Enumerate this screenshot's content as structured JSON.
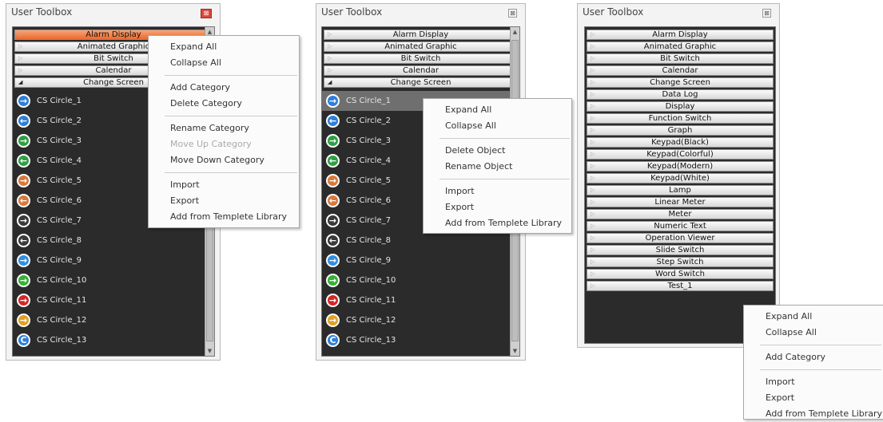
{
  "panel1": {
    "title": "User Toolbox",
    "categories": [
      {
        "label": "Alarm Display"
      },
      {
        "label": "Animated Graphic"
      },
      {
        "label": "Bit Switch"
      },
      {
        "label": "Calendar"
      },
      {
        "label": "Change Screen"
      }
    ],
    "items": [
      {
        "label": "CS Circle_1",
        "color": "#2f7fd8",
        "arrow": "→"
      },
      {
        "label": "CS Circle_2",
        "color": "#2f7fd8",
        "arrow": "←"
      },
      {
        "label": "CS Circle_3",
        "color": "#2ea043",
        "arrow": "→"
      },
      {
        "label": "CS Circle_4",
        "color": "#2ea043",
        "arrow": "←"
      },
      {
        "label": "CS Circle_5",
        "color": "#d9783a",
        "arrow": "→"
      },
      {
        "label": "CS Circle_6",
        "color": "#d9783a",
        "arrow": "←"
      },
      {
        "label": "CS Circle_7",
        "color": "#3a3a3a",
        "arrow": "→"
      },
      {
        "label": "CS Circle_8",
        "color": "#3a3a3a",
        "arrow": "←"
      },
      {
        "label": "CS Circle_9",
        "color": "#2f8fe0",
        "arrow": "→"
      },
      {
        "label": "CS Circle_10",
        "color": "#34b233",
        "arrow": "→"
      },
      {
        "label": "CS Circle_11",
        "color": "#d42626",
        "arrow": "→"
      },
      {
        "label": "CS Circle_12",
        "color": "#e0a020",
        "arrow": "→"
      },
      {
        "label": "CS Circle_13",
        "color": "#2f7fd8",
        "arrow": "C"
      }
    ],
    "menu": [
      {
        "label": "Expand All"
      },
      {
        "label": "Collapse All"
      },
      {
        "sep": true
      },
      {
        "label": "Add Category"
      },
      {
        "label": "Delete Category"
      },
      {
        "sep": true
      },
      {
        "label": "Rename Category"
      },
      {
        "label": "Move Up Category",
        "disabled": true
      },
      {
        "label": "Move Down Category"
      },
      {
        "sep": true
      },
      {
        "label": "Import"
      },
      {
        "label": "Export"
      },
      {
        "label": "Add from Templete Library"
      }
    ]
  },
  "panel2": {
    "title": "User Toolbox",
    "categories": [
      {
        "label": "Alarm Display"
      },
      {
        "label": "Animated Graphic"
      },
      {
        "label": "Bit Switch"
      },
      {
        "label": "Calendar"
      },
      {
        "label": "Change Screen"
      }
    ],
    "items": [
      {
        "label": "CS Circle_1",
        "color": "#2f7fd8",
        "arrow": "→"
      },
      {
        "label": "CS Circle_2",
        "color": "#2f7fd8",
        "arrow": "←"
      },
      {
        "label": "CS Circle_3",
        "color": "#2ea043",
        "arrow": "→"
      },
      {
        "label": "CS Circle_4",
        "color": "#2ea043",
        "arrow": "←"
      },
      {
        "label": "CS Circle_5",
        "color": "#d9783a",
        "arrow": "→"
      },
      {
        "label": "CS Circle_6",
        "color": "#d9783a",
        "arrow": "←"
      },
      {
        "label": "CS Circle_7",
        "color": "#3a3a3a",
        "arrow": "→"
      },
      {
        "label": "CS Circle_8",
        "color": "#3a3a3a",
        "arrow": "←"
      },
      {
        "label": "CS Circle_9",
        "color": "#2f8fe0",
        "arrow": "→"
      },
      {
        "label": "CS Circle_10",
        "color": "#34b233",
        "arrow": "→"
      },
      {
        "label": "CS Circle_11",
        "color": "#d42626",
        "arrow": "→"
      },
      {
        "label": "CS Circle_12",
        "color": "#e0a020",
        "arrow": "→"
      },
      {
        "label": "CS Circle_13",
        "color": "#2f7fd8",
        "arrow": "C"
      }
    ],
    "menu": [
      {
        "label": "Expand All"
      },
      {
        "label": "Collapse All"
      },
      {
        "sep": true
      },
      {
        "label": "Delete Object"
      },
      {
        "label": "Rename Object"
      },
      {
        "sep": true
      },
      {
        "label": "Import"
      },
      {
        "label": "Export"
      },
      {
        "label": "Add from Templete Library"
      }
    ]
  },
  "panel3": {
    "title": "User Toolbox",
    "categories": [
      {
        "label": "Alarm Display"
      },
      {
        "label": "Animated Graphic"
      },
      {
        "label": "Bit Switch"
      },
      {
        "label": "Calendar"
      },
      {
        "label": "Change Screen"
      },
      {
        "label": "Data Log"
      },
      {
        "label": "Display"
      },
      {
        "label": "Function Switch"
      },
      {
        "label": "Graph"
      },
      {
        "label": "Keypad(Black)"
      },
      {
        "label": "Keypad(Colorful)"
      },
      {
        "label": "Keypad(Modern)"
      },
      {
        "label": "Keypad(White)"
      },
      {
        "label": "Lamp"
      },
      {
        "label": "Linear Meter"
      },
      {
        "label": "Meter"
      },
      {
        "label": "Numeric Text"
      },
      {
        "label": "Operation Viewer"
      },
      {
        "label": "Slide Switch"
      },
      {
        "label": "Step Switch"
      },
      {
        "label": "Word Switch"
      },
      {
        "label": "Test_1"
      }
    ],
    "menu": [
      {
        "label": "Expand All"
      },
      {
        "label": "Collapse All"
      },
      {
        "sep": true
      },
      {
        "label": "Add Category"
      },
      {
        "sep": true
      },
      {
        "label": "Import"
      },
      {
        "label": "Export"
      },
      {
        "label": "Add from Templete Library"
      }
    ]
  },
  "close_glyph": "⊠",
  "collapsed_arrow": "▷",
  "expanded_arrow": "◢"
}
